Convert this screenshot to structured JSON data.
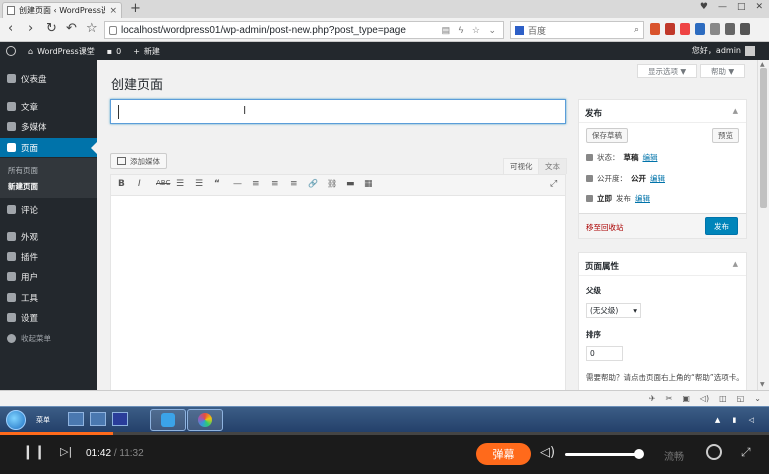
{
  "browser": {
    "tab_title": "创建页面 ‹ WordPress课堂",
    "new_tab_icon": "plus-icon",
    "url": "localhost/wordpress01/wp-admin/post-new.php?post_type=page",
    "search_placeholder": "百度"
  },
  "admin_bar": {
    "site_name": "WordPress课堂",
    "comments_count": "0",
    "new_label": "新建",
    "greeting": "您好，admin"
  },
  "sidebar": {
    "items": [
      {
        "label": "仪表盘",
        "icon": "dashboard-icon"
      },
      {
        "label": "文章",
        "icon": "pin-icon"
      },
      {
        "label": "多媒体",
        "icon": "media-icon"
      },
      {
        "label": "页面",
        "icon": "pages-icon"
      },
      {
        "label": "评论",
        "icon": "comment-icon"
      },
      {
        "label": "外观",
        "icon": "appearance-icon"
      },
      {
        "label": "插件",
        "icon": "plugin-icon"
      },
      {
        "label": "用户",
        "icon": "user-icon"
      },
      {
        "label": "工具",
        "icon": "tool-icon"
      },
      {
        "label": "设置",
        "icon": "settings-icon"
      },
      {
        "label": "收起菜单",
        "icon": "collapse-icon"
      }
    ],
    "submenu": [
      "所有页面",
      "新建页面"
    ]
  },
  "screen_options": {
    "screen_options_label": "显示选项 ▼",
    "help_label": "帮助 ▼"
  },
  "editor": {
    "page_title": "创建页面",
    "title_value": "",
    "add_media_label": "添加媒体",
    "tab_visual": "可视化",
    "tab_text": "文本",
    "toolbar": [
      "B",
      "I",
      "ABC",
      "☰",
      "☰",
      "“",
      "—",
      "≡",
      "≡",
      "≡",
      "🔗",
      "⛓",
      "▬",
      "▦"
    ],
    "fullscreen_icon": "⤢"
  },
  "publish_box": {
    "title": "发布",
    "save_draft": "保存草稿",
    "preview": "预览",
    "status_label": "状态：",
    "status_value": "草稿",
    "visibility_label": "公开度：",
    "visibility_value": "公开",
    "publish_label": "立即",
    "publish_suffix": "发布",
    "edit_link": "编辑",
    "trash_link": "移至回收站",
    "publish_button": "发布"
  },
  "attributes_box": {
    "title": "页面属性",
    "parent_label": "父级",
    "parent_value": "(无父级)",
    "order_label": "排序",
    "order_value": "0",
    "help_text": "需要帮助？请点击页面右上角的“帮助”选项卡。"
  },
  "taskbar": {
    "start_label": "菜单"
  },
  "player": {
    "current_time": "01:42",
    "duration": "/ 11:32",
    "progress_fraction": 0.147,
    "danmu_label": "弹幕",
    "quality_label": "流畅",
    "accent_color": "#ff6a1b"
  }
}
